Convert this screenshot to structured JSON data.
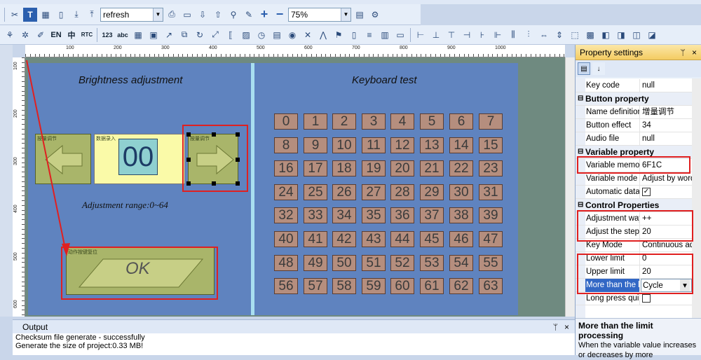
{
  "toolbar": {
    "action_combo": "refresh",
    "zoom_combo": "75%",
    "lang_en": "EN",
    "lang_cn": "中",
    "rtc_label": "RTC",
    "num_label": "123",
    "abc_label": "abc"
  },
  "ruler": {
    "h_labels": [
      "100",
      "200",
      "300",
      "400",
      "500",
      "600",
      "700",
      "800",
      "900",
      "1000"
    ],
    "v_labels": [
      "100",
      "200",
      "300",
      "400",
      "500",
      "600"
    ]
  },
  "canvas": {
    "left_title": "Brightness adjustment",
    "right_title": "Keyboard test",
    "left_button_caption": "按量调节",
    "number_caption": "数据录入",
    "number_value": "00",
    "right_button_caption": "按量调节",
    "adjustment_range": "Adjustment range:0~64",
    "ok_caption": "动作按键复位",
    "ok_label": "OK",
    "keys": [
      "0",
      "1",
      "2",
      "3",
      "4",
      "5",
      "6",
      "7",
      "8",
      "9",
      "10",
      "11",
      "12",
      "13",
      "14",
      "15",
      "16",
      "17",
      "18",
      "19",
      "20",
      "21",
      "22",
      "23",
      "24",
      "25",
      "26",
      "27",
      "28",
      "29",
      "30",
      "31",
      "32",
      "33",
      "34",
      "35",
      "36",
      "37",
      "38",
      "39",
      "40",
      "41",
      "42",
      "43",
      "44",
      "45",
      "46",
      "47",
      "48",
      "49",
      "50",
      "51",
      "52",
      "53",
      "54",
      "55",
      "56",
      "57",
      "58",
      "59",
      "60",
      "61",
      "62",
      "63"
    ]
  },
  "output": {
    "title": "Output",
    "pin": "ᛘ",
    "close": "×",
    "lines": [
      "Checksum file generate - successfully",
      "Generate the size of project:0.33 MB!"
    ]
  },
  "properties": {
    "title": "Property settings",
    "pin": "ᛘ",
    "close": "×",
    "rows": [
      {
        "type": "row",
        "name": "Key code",
        "value": "null"
      },
      {
        "type": "cat",
        "name": "Button property"
      },
      {
        "type": "row",
        "name": "Name definition",
        "value": "增量调节"
      },
      {
        "type": "row",
        "name": "Button effect",
        "value": "34"
      },
      {
        "type": "row",
        "name": "Audio file",
        "value": "null"
      },
      {
        "type": "cat",
        "name": "Variable property"
      },
      {
        "type": "row",
        "name": "Variable memory",
        "value": "6F1C"
      },
      {
        "type": "row",
        "name": "Variable mode",
        "value": "Adjust by word"
      },
      {
        "type": "row",
        "name": "Automatic data",
        "value": "",
        "checkbox": true,
        "checked": true
      },
      {
        "type": "cat",
        "name": "Control Properties"
      },
      {
        "type": "row",
        "name": "Adjustment way",
        "value": "++"
      },
      {
        "type": "row",
        "name": "Adjust the step",
        "value": "20"
      },
      {
        "type": "row",
        "name": "Key Mode",
        "value": "Continuous adjust"
      },
      {
        "type": "row",
        "name": "Lower limit",
        "value": "0"
      },
      {
        "type": "row",
        "name": "Upper limit",
        "value": "20"
      },
      {
        "type": "row",
        "name": "More than the limit",
        "value": "Cycle",
        "selected": true,
        "dropdown": true
      },
      {
        "type": "row",
        "name": "Long press quick",
        "value": "",
        "checkbox": true,
        "checked": false
      }
    ],
    "description_title": "More than the limit processing",
    "description_text": "When the variable value increases or decreases by more"
  }
}
